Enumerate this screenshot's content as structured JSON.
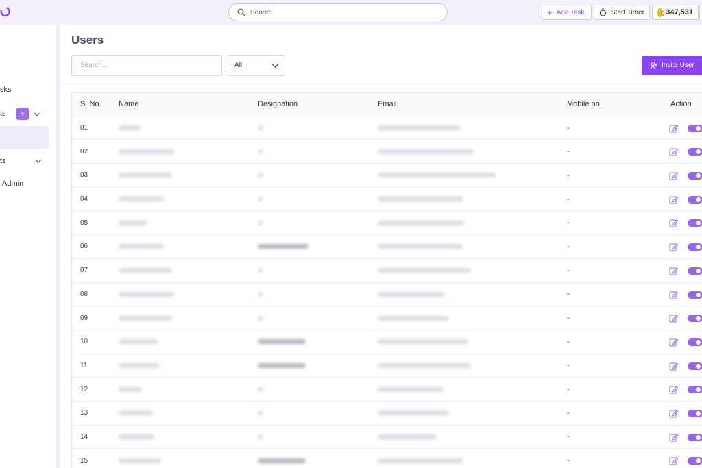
{
  "topbar": {
    "search_placeholder": "Search",
    "add_task_label": "Add Task",
    "start_timer_label": "Start Timer",
    "coins_value": "347,531"
  },
  "sidebar": {
    "items": [
      {
        "label": "sks"
      },
      {
        "label": "ts"
      },
      {
        "label": "ts"
      },
      {
        "label": "Admin"
      }
    ]
  },
  "main": {
    "title": "Users",
    "search_placeholder": "Search...",
    "filter_value": "All",
    "invite_label": "Invite User",
    "columns": [
      "S. No.",
      "Name",
      "Designation",
      "Email",
      "Mobile no.",
      "Action"
    ],
    "rows": [
      {
        "sno": "01",
        "mobile": "-"
      },
      {
        "sno": "02",
        "mobile": "-"
      },
      {
        "sno": "03",
        "mobile": "-"
      },
      {
        "sno": "04",
        "mobile": "-"
      },
      {
        "sno": "05",
        "mobile": "-"
      },
      {
        "sno": "06",
        "mobile": "-"
      },
      {
        "sno": "07",
        "mobile": "-"
      },
      {
        "sno": "08",
        "mobile": "-"
      },
      {
        "sno": "09",
        "mobile": "-"
      },
      {
        "sno": "10",
        "mobile": "-"
      },
      {
        "sno": "11",
        "mobile": "-"
      },
      {
        "sno": "12",
        "mobile": "-"
      },
      {
        "sno": "13",
        "mobile": "-"
      },
      {
        "sno": "14",
        "mobile": "-"
      },
      {
        "sno": "15",
        "mobile": "-"
      }
    ]
  },
  "colors": {
    "accent": "#8b45f0",
    "toggle": "#9966ea",
    "topbar_bg": "#f4f0fb"
  }
}
